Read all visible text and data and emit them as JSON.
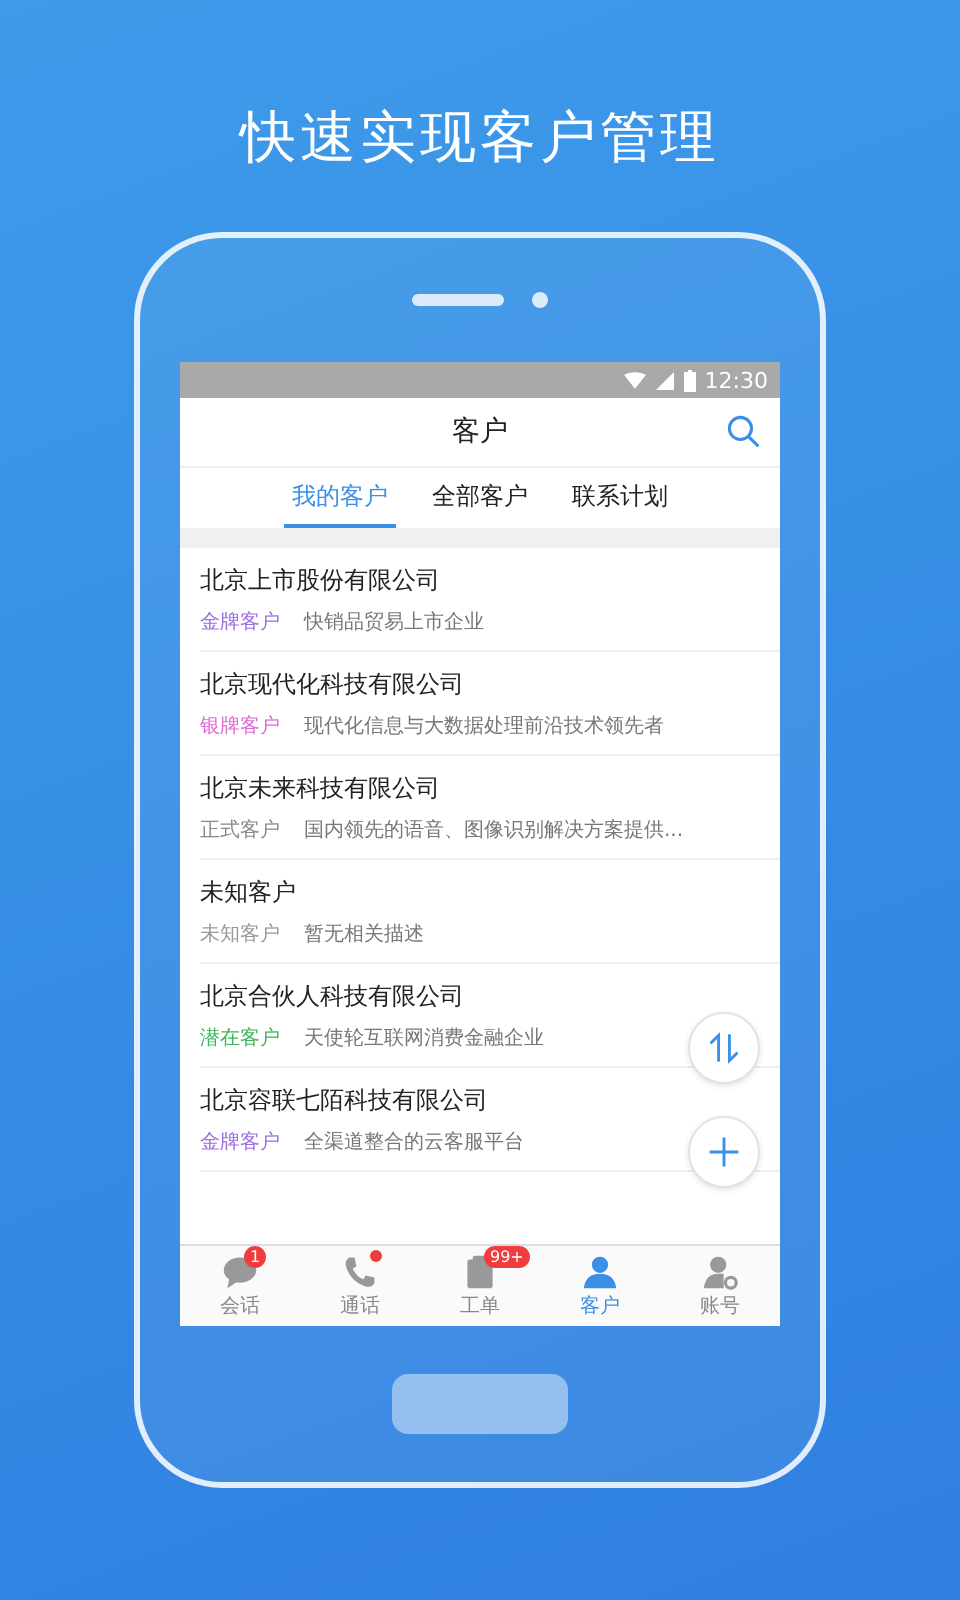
{
  "headline": "快速实现客户管理",
  "status_bar": {
    "time": "12:30"
  },
  "header": {
    "title": "客户"
  },
  "tabs": [
    {
      "label": "我的客户",
      "selected": true
    },
    {
      "label": "全部客户",
      "selected": false
    },
    {
      "label": "联系计划",
      "selected": false
    }
  ],
  "customers": [
    {
      "name": "北京上市股份有限公司",
      "tag": "金牌客户",
      "color": "#9b6fe0",
      "description": "快销品贸易上市企业"
    },
    {
      "name": "北京现代化科技有限公司",
      "tag": "银牌客户",
      "color": "#e06ad8",
      "description": "现代化信息与大数据处理前沿技术领先者"
    },
    {
      "name": "北京未来科技有限公司",
      "tag": "正式客户",
      "color": "#888888",
      "description": "国内领先的语音、图像识别解决方案提供..."
    },
    {
      "name": "未知客户",
      "tag": "未知客户",
      "color": "#999999",
      "description": "暂无相关描述"
    },
    {
      "name": "北京合伙人科技有限公司",
      "tag": "潜在客户",
      "color": "#3cb55a",
      "description": "天使轮互联网消费金融企业"
    },
    {
      "name": "北京容联七陌科技有限公司",
      "tag": "金牌客户",
      "color": "#9b6fe0",
      "description": "全渠道整合的云客服平台"
    }
  ],
  "bottom_nav": [
    {
      "kind": "chat",
      "label": "会话",
      "badge": "1",
      "dot": false,
      "selected": false
    },
    {
      "kind": "phone",
      "label": "通话",
      "dot": true,
      "selected": false
    },
    {
      "kind": "clipboard",
      "label": "工单",
      "badge": "99+",
      "dot": false,
      "selected": false
    },
    {
      "kind": "person",
      "label": "客户",
      "dot": false,
      "selected": true
    },
    {
      "kind": "account",
      "label": "账号",
      "dot": false,
      "selected": false
    }
  ]
}
